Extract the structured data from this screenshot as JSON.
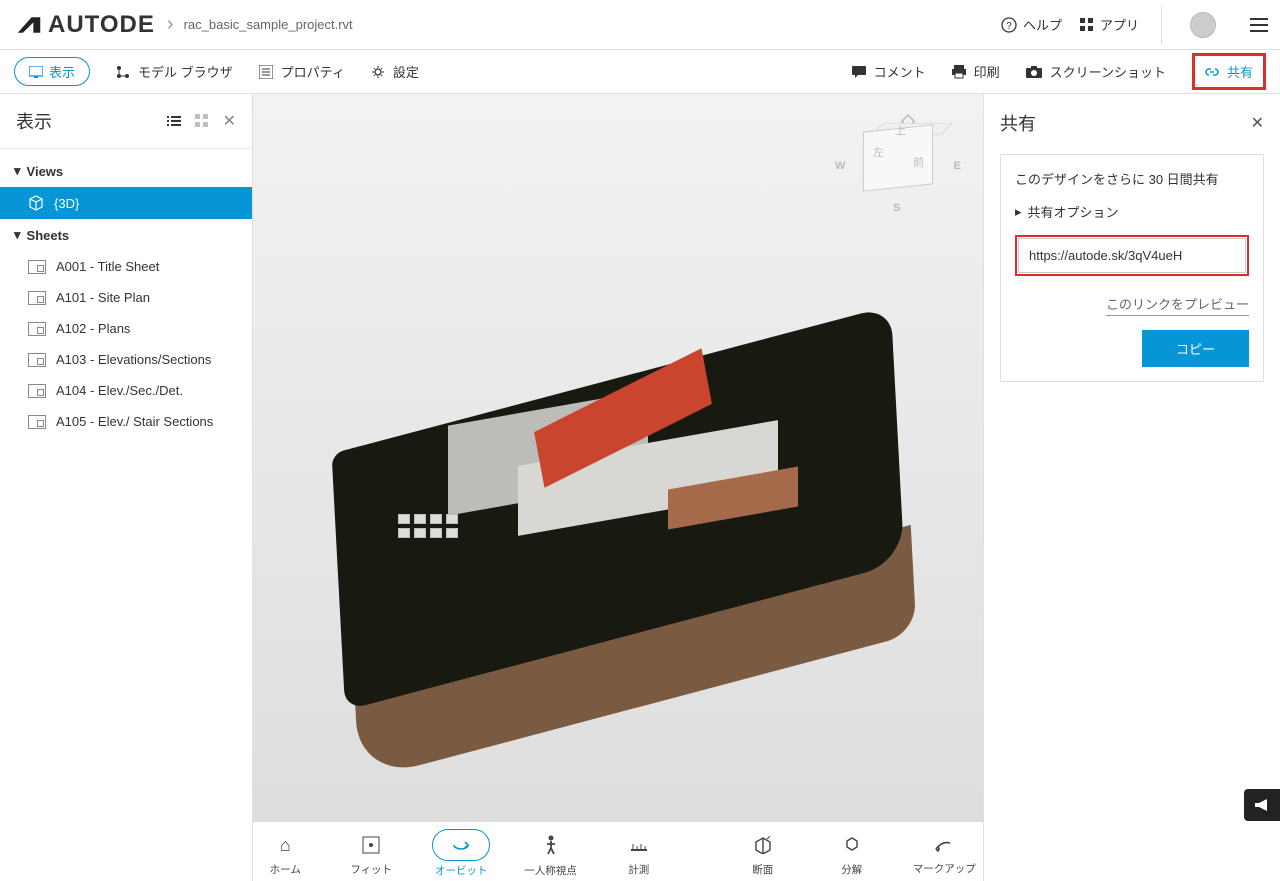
{
  "header": {
    "brand": "AUTODE",
    "breadcrumb": "rac_basic_sample_project.rvt",
    "help": "ヘルプ",
    "apps": "アプリ"
  },
  "toolbar": {
    "view_btn": "表示",
    "model_browser": "モデル ブラウザ",
    "properties": "プロパティ",
    "settings": "設定",
    "comments": "コメント",
    "print": "印刷",
    "screenshot": "スクリーンショット",
    "share": "共有"
  },
  "sidebar": {
    "title": "表示",
    "views_group": "Views",
    "view_3d": "{3D}",
    "sheets_group": "Sheets",
    "sheets": [
      "A001 - Title Sheet",
      "A101 - Site Plan",
      "A102 - Plans",
      "A103 - Elevations/Sections",
      "A104 - Elev./Sec./Det.",
      "A105 - Elev./ Stair Sections"
    ]
  },
  "viewcube": {
    "top": "上",
    "left": "左",
    "front": "前",
    "w": "W",
    "e": "E",
    "s": "S"
  },
  "share": {
    "title": "共有",
    "subtitle": "このデザインをさらに 30 日間共有",
    "options": "共有オプション",
    "url": "https://autode.sk/3qV4ueH",
    "preview": "このリンクをプレビュー",
    "copy": "コピー"
  },
  "tray": {
    "home": "ホーム",
    "fit": "フィット",
    "orbit": "オービット",
    "firstperson": "一人称視点",
    "measure": "計測",
    "section": "断面",
    "explode": "分解",
    "markup": "マークアップ"
  }
}
